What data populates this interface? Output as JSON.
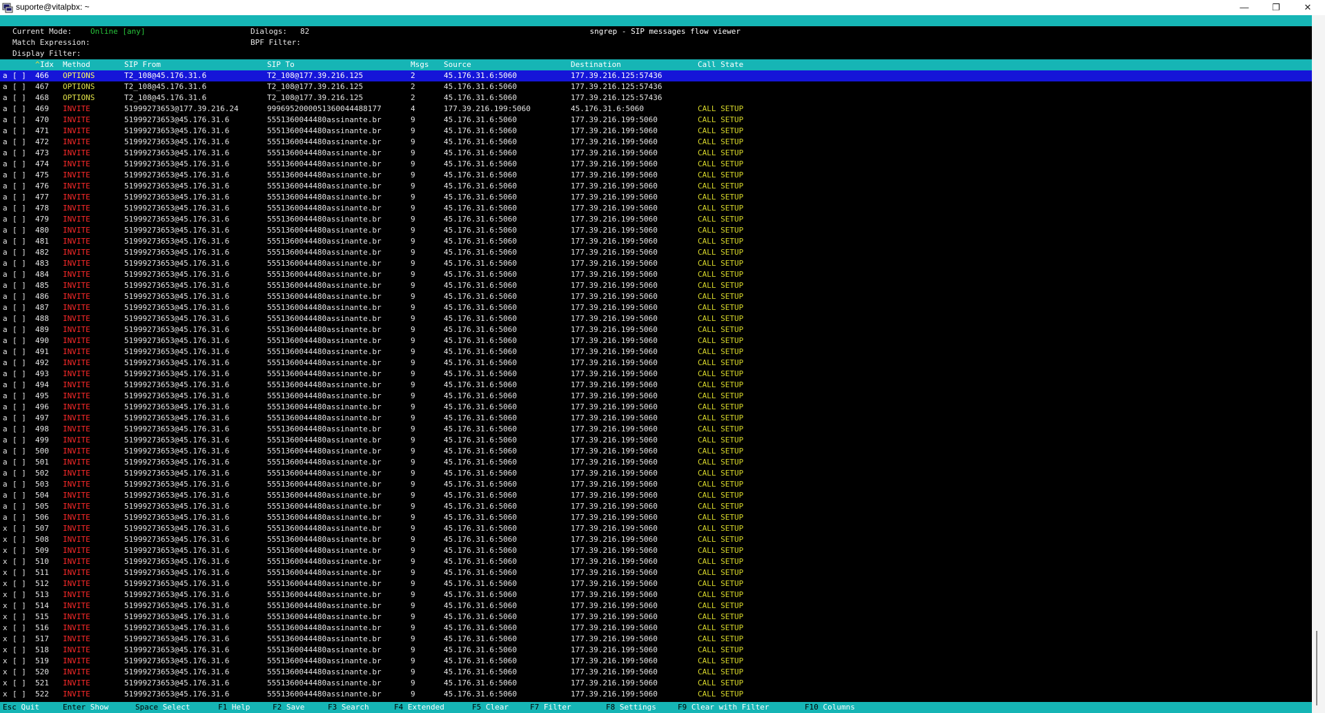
{
  "window": {
    "title": "suporte@vitalpbx: ~",
    "min_glyph": "—",
    "max_glyph": "❐",
    "close_glyph": "✕",
    "icon": "putty-terminal-icon"
  },
  "app": {
    "title": "sngrep - SIP messages flow viewer"
  },
  "info": {
    "mode_label": "Current Mode:",
    "mode_value": "Online [any]",
    "dialogs_label": "Dialogs:",
    "dialogs_value": "82",
    "match_label": "Match Expression:",
    "bpf_label": "BPF Filter:",
    "display_label": "Display Filter:"
  },
  "columns": {
    "sort_indicator": "^",
    "idx": "Idx",
    "method": "Method",
    "sip_from": "SIP From",
    "sip_to": "SIP To",
    "msgs": "Msgs",
    "source": "Source",
    "destination": "Destination",
    "call_state": "Call State"
  },
  "selected_index": 0,
  "calls": [
    {
      "flag": "a",
      "check": "[ ]",
      "idx": "466",
      "method": "OPTIONS",
      "from": "T2_108@45.176.31.6",
      "to": "T2_108@177.39.216.125",
      "msgs": "2",
      "source": "45.176.31.6:5060",
      "destination": "177.39.216.125:57436",
      "state": ""
    },
    {
      "flag": "a",
      "check": "[ ]",
      "idx": "467",
      "method": "OPTIONS",
      "from": "T2_108@45.176.31.6",
      "to": "T2_108@177.39.216.125",
      "msgs": "2",
      "source": "45.176.31.6:5060",
      "destination": "177.39.216.125:57436",
      "state": ""
    },
    {
      "flag": "a",
      "check": "[ ]",
      "idx": "468",
      "method": "OPTIONS",
      "from": "T2_108@45.176.31.6",
      "to": "T2_108@177.39.216.125",
      "msgs": "2",
      "source": "45.176.31.6:5060",
      "destination": "177.39.216.125:57436",
      "state": ""
    },
    {
      "flag": "a",
      "check": "[ ]",
      "idx": "469",
      "method": "INVITE",
      "from": "51999273653@177.39.216.24",
      "to": "9996952000051360044488177",
      "msgs": "4",
      "source": "177.39.216.199:5060",
      "destination": "45.176.31.6:5060",
      "state": "CALL SETUP"
    },
    {
      "flag": "a",
      "check": "[ ]",
      "idx": "470",
      "method": "INVITE",
      "from": "51999273653@45.176.31.6",
      "to": "5551360044480assinante.br",
      "msgs": "9",
      "source": "45.176.31.6:5060",
      "destination": "177.39.216.199:5060",
      "state": "CALL SETUP"
    },
    {
      "flag": "a",
      "check": "[ ]",
      "idx": "471",
      "method": "INVITE",
      "from": "51999273653@45.176.31.6",
      "to": "5551360044480assinante.br",
      "msgs": "9",
      "source": "45.176.31.6:5060",
      "destination": "177.39.216.199:5060",
      "state": "CALL SETUP"
    },
    {
      "flag": "a",
      "check": "[ ]",
      "idx": "472",
      "method": "INVITE",
      "from": "51999273653@45.176.31.6",
      "to": "5551360044480assinante.br",
      "msgs": "9",
      "source": "45.176.31.6:5060",
      "destination": "177.39.216.199:5060",
      "state": "CALL SETUP"
    },
    {
      "flag": "a",
      "check": "[ ]",
      "idx": "473",
      "method": "INVITE",
      "from": "51999273653@45.176.31.6",
      "to": "5551360044480assinante.br",
      "msgs": "9",
      "source": "45.176.31.6:5060",
      "destination": "177.39.216.199:5060",
      "state": "CALL SETUP"
    },
    {
      "flag": "a",
      "check": "[ ]",
      "idx": "474",
      "method": "INVITE",
      "from": "51999273653@45.176.31.6",
      "to": "5551360044480assinante.br",
      "msgs": "9",
      "source": "45.176.31.6:5060",
      "destination": "177.39.216.199:5060",
      "state": "CALL SETUP"
    },
    {
      "flag": "a",
      "check": "[ ]",
      "idx": "475",
      "method": "INVITE",
      "from": "51999273653@45.176.31.6",
      "to": "5551360044480assinante.br",
      "msgs": "9",
      "source": "45.176.31.6:5060",
      "destination": "177.39.216.199:5060",
      "state": "CALL SETUP"
    },
    {
      "flag": "a",
      "check": "[ ]",
      "idx": "476",
      "method": "INVITE",
      "from": "51999273653@45.176.31.6",
      "to": "5551360044480assinante.br",
      "msgs": "9",
      "source": "45.176.31.6:5060",
      "destination": "177.39.216.199:5060",
      "state": "CALL SETUP"
    },
    {
      "flag": "a",
      "check": "[ ]",
      "idx": "477",
      "method": "INVITE",
      "from": "51999273653@45.176.31.6",
      "to": "5551360044480assinante.br",
      "msgs": "9",
      "source": "45.176.31.6:5060",
      "destination": "177.39.216.199:5060",
      "state": "CALL SETUP"
    },
    {
      "flag": "a",
      "check": "[ ]",
      "idx": "478",
      "method": "INVITE",
      "from": "51999273653@45.176.31.6",
      "to": "5551360044480assinante.br",
      "msgs": "9",
      "source": "45.176.31.6:5060",
      "destination": "177.39.216.199:5060",
      "state": "CALL SETUP"
    },
    {
      "flag": "a",
      "check": "[ ]",
      "idx": "479",
      "method": "INVITE",
      "from": "51999273653@45.176.31.6",
      "to": "5551360044480assinante.br",
      "msgs": "9",
      "source": "45.176.31.6:5060",
      "destination": "177.39.216.199:5060",
      "state": "CALL SETUP"
    },
    {
      "flag": "a",
      "check": "[ ]",
      "idx": "480",
      "method": "INVITE",
      "from": "51999273653@45.176.31.6",
      "to": "5551360044480assinante.br",
      "msgs": "9",
      "source": "45.176.31.6:5060",
      "destination": "177.39.216.199:5060",
      "state": "CALL SETUP"
    },
    {
      "flag": "a",
      "check": "[ ]",
      "idx": "481",
      "method": "INVITE",
      "from": "51999273653@45.176.31.6",
      "to": "5551360044480assinante.br",
      "msgs": "9",
      "source": "45.176.31.6:5060",
      "destination": "177.39.216.199:5060",
      "state": "CALL SETUP"
    },
    {
      "flag": "a",
      "check": "[ ]",
      "idx": "482",
      "method": "INVITE",
      "from": "51999273653@45.176.31.6",
      "to": "5551360044480assinante.br",
      "msgs": "9",
      "source": "45.176.31.6:5060",
      "destination": "177.39.216.199:5060",
      "state": "CALL SETUP"
    },
    {
      "flag": "a",
      "check": "[ ]",
      "idx": "483",
      "method": "INVITE",
      "from": "51999273653@45.176.31.6",
      "to": "5551360044480assinante.br",
      "msgs": "9",
      "source": "45.176.31.6:5060",
      "destination": "177.39.216.199:5060",
      "state": "CALL SETUP"
    },
    {
      "flag": "a",
      "check": "[ ]",
      "idx": "484",
      "method": "INVITE",
      "from": "51999273653@45.176.31.6",
      "to": "5551360044480assinante.br",
      "msgs": "9",
      "source": "45.176.31.6:5060",
      "destination": "177.39.216.199:5060",
      "state": "CALL SETUP"
    },
    {
      "flag": "a",
      "check": "[ ]",
      "idx": "485",
      "method": "INVITE",
      "from": "51999273653@45.176.31.6",
      "to": "5551360044480assinante.br",
      "msgs": "9",
      "source": "45.176.31.6:5060",
      "destination": "177.39.216.199:5060",
      "state": "CALL SETUP"
    },
    {
      "flag": "a",
      "check": "[ ]",
      "idx": "486",
      "method": "INVITE",
      "from": "51999273653@45.176.31.6",
      "to": "5551360044480assinante.br",
      "msgs": "9",
      "source": "45.176.31.6:5060",
      "destination": "177.39.216.199:5060",
      "state": "CALL SETUP"
    },
    {
      "flag": "a",
      "check": "[ ]",
      "idx": "487",
      "method": "INVITE",
      "from": "51999273653@45.176.31.6",
      "to": "5551360044480assinante.br",
      "msgs": "9",
      "source": "45.176.31.6:5060",
      "destination": "177.39.216.199:5060",
      "state": "CALL SETUP"
    },
    {
      "flag": "a",
      "check": "[ ]",
      "idx": "488",
      "method": "INVITE",
      "from": "51999273653@45.176.31.6",
      "to": "5551360044480assinante.br",
      "msgs": "9",
      "source": "45.176.31.6:5060",
      "destination": "177.39.216.199:5060",
      "state": "CALL SETUP"
    },
    {
      "flag": "a",
      "check": "[ ]",
      "idx": "489",
      "method": "INVITE",
      "from": "51999273653@45.176.31.6",
      "to": "5551360044480assinante.br",
      "msgs": "9",
      "source": "45.176.31.6:5060",
      "destination": "177.39.216.199:5060",
      "state": "CALL SETUP"
    },
    {
      "flag": "a",
      "check": "[ ]",
      "idx": "490",
      "method": "INVITE",
      "from": "51999273653@45.176.31.6",
      "to": "5551360044480assinante.br",
      "msgs": "9",
      "source": "45.176.31.6:5060",
      "destination": "177.39.216.199:5060",
      "state": "CALL SETUP"
    },
    {
      "flag": "a",
      "check": "[ ]",
      "idx": "491",
      "method": "INVITE",
      "from": "51999273653@45.176.31.6",
      "to": "5551360044480assinante.br",
      "msgs": "9",
      "source": "45.176.31.6:5060",
      "destination": "177.39.216.199:5060",
      "state": "CALL SETUP"
    },
    {
      "flag": "a",
      "check": "[ ]",
      "idx": "492",
      "method": "INVITE",
      "from": "51999273653@45.176.31.6",
      "to": "5551360044480assinante.br",
      "msgs": "9",
      "source": "45.176.31.6:5060",
      "destination": "177.39.216.199:5060",
      "state": "CALL SETUP"
    },
    {
      "flag": "a",
      "check": "[ ]",
      "idx": "493",
      "method": "INVITE",
      "from": "51999273653@45.176.31.6",
      "to": "5551360044480assinante.br",
      "msgs": "9",
      "source": "45.176.31.6:5060",
      "destination": "177.39.216.199:5060",
      "state": "CALL SETUP"
    },
    {
      "flag": "a",
      "check": "[ ]",
      "idx": "494",
      "method": "INVITE",
      "from": "51999273653@45.176.31.6",
      "to": "5551360044480assinante.br",
      "msgs": "9",
      "source": "45.176.31.6:5060",
      "destination": "177.39.216.199:5060",
      "state": "CALL SETUP"
    },
    {
      "flag": "a",
      "check": "[ ]",
      "idx": "495",
      "method": "INVITE",
      "from": "51999273653@45.176.31.6",
      "to": "5551360044480assinante.br",
      "msgs": "9",
      "source": "45.176.31.6:5060",
      "destination": "177.39.216.199:5060",
      "state": "CALL SETUP"
    },
    {
      "flag": "a",
      "check": "[ ]",
      "idx": "496",
      "method": "INVITE",
      "from": "51999273653@45.176.31.6",
      "to": "5551360044480assinante.br",
      "msgs": "9",
      "source": "45.176.31.6:5060",
      "destination": "177.39.216.199:5060",
      "state": "CALL SETUP"
    },
    {
      "flag": "a",
      "check": "[ ]",
      "idx": "497",
      "method": "INVITE",
      "from": "51999273653@45.176.31.6",
      "to": "5551360044480assinante.br",
      "msgs": "9",
      "source": "45.176.31.6:5060",
      "destination": "177.39.216.199:5060",
      "state": "CALL SETUP"
    },
    {
      "flag": "a",
      "check": "[ ]",
      "idx": "498",
      "method": "INVITE",
      "from": "51999273653@45.176.31.6",
      "to": "5551360044480assinante.br",
      "msgs": "9",
      "source": "45.176.31.6:5060",
      "destination": "177.39.216.199:5060",
      "state": "CALL SETUP"
    },
    {
      "flag": "a",
      "check": "[ ]",
      "idx": "499",
      "method": "INVITE",
      "from": "51999273653@45.176.31.6",
      "to": "5551360044480assinante.br",
      "msgs": "9",
      "source": "45.176.31.6:5060",
      "destination": "177.39.216.199:5060",
      "state": "CALL SETUP"
    },
    {
      "flag": "a",
      "check": "[ ]",
      "idx": "500",
      "method": "INVITE",
      "from": "51999273653@45.176.31.6",
      "to": "5551360044480assinante.br",
      "msgs": "9",
      "source": "45.176.31.6:5060",
      "destination": "177.39.216.199:5060",
      "state": "CALL SETUP"
    },
    {
      "flag": "a",
      "check": "[ ]",
      "idx": "501",
      "method": "INVITE",
      "from": "51999273653@45.176.31.6",
      "to": "5551360044480assinante.br",
      "msgs": "9",
      "source": "45.176.31.6:5060",
      "destination": "177.39.216.199:5060",
      "state": "CALL SETUP"
    },
    {
      "flag": "a",
      "check": "[ ]",
      "idx": "502",
      "method": "INVITE",
      "from": "51999273653@45.176.31.6",
      "to": "5551360044480assinante.br",
      "msgs": "9",
      "source": "45.176.31.6:5060",
      "destination": "177.39.216.199:5060",
      "state": "CALL SETUP"
    },
    {
      "flag": "a",
      "check": "[ ]",
      "idx": "503",
      "method": "INVITE",
      "from": "51999273653@45.176.31.6",
      "to": "5551360044480assinante.br",
      "msgs": "9",
      "source": "45.176.31.6:5060",
      "destination": "177.39.216.199:5060",
      "state": "CALL SETUP"
    },
    {
      "flag": "a",
      "check": "[ ]",
      "idx": "504",
      "method": "INVITE",
      "from": "51999273653@45.176.31.6",
      "to": "5551360044480assinante.br",
      "msgs": "9",
      "source": "45.176.31.6:5060",
      "destination": "177.39.216.199:5060",
      "state": "CALL SETUP"
    },
    {
      "flag": "a",
      "check": "[ ]",
      "idx": "505",
      "method": "INVITE",
      "from": "51999273653@45.176.31.6",
      "to": "5551360044480assinante.br",
      "msgs": "9",
      "source": "45.176.31.6:5060",
      "destination": "177.39.216.199:5060",
      "state": "CALL SETUP"
    },
    {
      "flag": "a",
      "check": "[ ]",
      "idx": "506",
      "method": "INVITE",
      "from": "51999273653@45.176.31.6",
      "to": "5551360044480assinante.br",
      "msgs": "9",
      "source": "45.176.31.6:5060",
      "destination": "177.39.216.199:5060",
      "state": "CALL SETUP"
    },
    {
      "flag": "x",
      "check": "[ ]",
      "idx": "507",
      "method": "INVITE",
      "from": "51999273653@45.176.31.6",
      "to": "5551360044480assinante.br",
      "msgs": "9",
      "source": "45.176.31.6:5060",
      "destination": "177.39.216.199:5060",
      "state": "CALL SETUP"
    },
    {
      "flag": "x",
      "check": "[ ]",
      "idx": "508",
      "method": "INVITE",
      "from": "51999273653@45.176.31.6",
      "to": "5551360044480assinante.br",
      "msgs": "9",
      "source": "45.176.31.6:5060",
      "destination": "177.39.216.199:5060",
      "state": "CALL SETUP"
    },
    {
      "flag": "x",
      "check": "[ ]",
      "idx": "509",
      "method": "INVITE",
      "from": "51999273653@45.176.31.6",
      "to": "5551360044480assinante.br",
      "msgs": "9",
      "source": "45.176.31.6:5060",
      "destination": "177.39.216.199:5060",
      "state": "CALL SETUP"
    },
    {
      "flag": "x",
      "check": "[ ]",
      "idx": "510",
      "method": "INVITE",
      "from": "51999273653@45.176.31.6",
      "to": "5551360044480assinante.br",
      "msgs": "9",
      "source": "45.176.31.6:5060",
      "destination": "177.39.216.199:5060",
      "state": "CALL SETUP"
    },
    {
      "flag": "x",
      "check": "[ ]",
      "idx": "511",
      "method": "INVITE",
      "from": "51999273653@45.176.31.6",
      "to": "5551360044480assinante.br",
      "msgs": "9",
      "source": "45.176.31.6:5060",
      "destination": "177.39.216.199:5060",
      "state": "CALL SETUP"
    },
    {
      "flag": "x",
      "check": "[ ]",
      "idx": "512",
      "method": "INVITE",
      "from": "51999273653@45.176.31.6",
      "to": "5551360044480assinante.br",
      "msgs": "9",
      "source": "45.176.31.6:5060",
      "destination": "177.39.216.199:5060",
      "state": "CALL SETUP"
    },
    {
      "flag": "x",
      "check": "[ ]",
      "idx": "513",
      "method": "INVITE",
      "from": "51999273653@45.176.31.6",
      "to": "5551360044480assinante.br",
      "msgs": "9",
      "source": "45.176.31.6:5060",
      "destination": "177.39.216.199:5060",
      "state": "CALL SETUP"
    },
    {
      "flag": "x",
      "check": "[ ]",
      "idx": "514",
      "method": "INVITE",
      "from": "51999273653@45.176.31.6",
      "to": "5551360044480assinante.br",
      "msgs": "9",
      "source": "45.176.31.6:5060",
      "destination": "177.39.216.199:5060",
      "state": "CALL SETUP"
    },
    {
      "flag": "x",
      "check": "[ ]",
      "idx": "515",
      "method": "INVITE",
      "from": "51999273653@45.176.31.6",
      "to": "5551360044480assinante.br",
      "msgs": "9",
      "source": "45.176.31.6:5060",
      "destination": "177.39.216.199:5060",
      "state": "CALL SETUP"
    },
    {
      "flag": "x",
      "check": "[ ]",
      "idx": "516",
      "method": "INVITE",
      "from": "51999273653@45.176.31.6",
      "to": "5551360044480assinante.br",
      "msgs": "9",
      "source": "45.176.31.6:5060",
      "destination": "177.39.216.199:5060",
      "state": "CALL SETUP"
    },
    {
      "flag": "x",
      "check": "[ ]",
      "idx": "517",
      "method": "INVITE",
      "from": "51999273653@45.176.31.6",
      "to": "5551360044480assinante.br",
      "msgs": "9",
      "source": "45.176.31.6:5060",
      "destination": "177.39.216.199:5060",
      "state": "CALL SETUP"
    },
    {
      "flag": "x",
      "check": "[ ]",
      "idx": "518",
      "method": "INVITE",
      "from": "51999273653@45.176.31.6",
      "to": "5551360044480assinante.br",
      "msgs": "9",
      "source": "45.176.31.6:5060",
      "destination": "177.39.216.199:5060",
      "state": "CALL SETUP"
    },
    {
      "flag": "x",
      "check": "[ ]",
      "idx": "519",
      "method": "INVITE",
      "from": "51999273653@45.176.31.6",
      "to": "5551360044480assinante.br",
      "msgs": "9",
      "source": "45.176.31.6:5060",
      "destination": "177.39.216.199:5060",
      "state": "CALL SETUP"
    },
    {
      "flag": "x",
      "check": "[ ]",
      "idx": "520",
      "method": "INVITE",
      "from": "51999273653@45.176.31.6",
      "to": "5551360044480assinante.br",
      "msgs": "9",
      "source": "45.176.31.6:5060",
      "destination": "177.39.216.199:5060",
      "state": "CALL SETUP"
    },
    {
      "flag": "x",
      "check": "[ ]",
      "idx": "521",
      "method": "INVITE",
      "from": "51999273653@45.176.31.6",
      "to": "5551360044480assinante.br",
      "msgs": "9",
      "source": "45.176.31.6:5060",
      "destination": "177.39.216.199:5060",
      "state": "CALL SETUP"
    },
    {
      "flag": "x",
      "check": "[ ]",
      "idx": "522",
      "method": "INVITE",
      "from": "51999273653@45.176.31.6",
      "to": "5551360044480assinante.br",
      "msgs": "9",
      "source": "45.176.31.6:5060",
      "destination": "177.39.216.199:5060",
      "state": "CALL SETUP"
    }
  ],
  "shortcuts": [
    {
      "key": "Esc",
      "label": "Quit"
    },
    {
      "key": "Enter",
      "label": "Show"
    },
    {
      "key": "Space",
      "label": "Select"
    },
    {
      "key": "F1",
      "label": "Help"
    },
    {
      "key": "F2",
      "label": "Save"
    },
    {
      "key": "F3",
      "label": "Search"
    },
    {
      "key": "F4",
      "label": "Extended"
    },
    {
      "key": "F5",
      "label": "Clear"
    },
    {
      "key": "F7",
      "label": "Filter"
    },
    {
      "key": "F8",
      "label": "Settings"
    },
    {
      "key": "F9",
      "label": "Clear with Filter"
    },
    {
      "key": "F10",
      "label": "Columns"
    }
  ],
  "colors": {
    "accent_bar": "#16b5b5",
    "selection": "#1515d8",
    "method_invite": "#ff2a2a",
    "method_options": "#e4e44a",
    "state_text": "#d8d82a",
    "online_text": "#27c43b"
  }
}
